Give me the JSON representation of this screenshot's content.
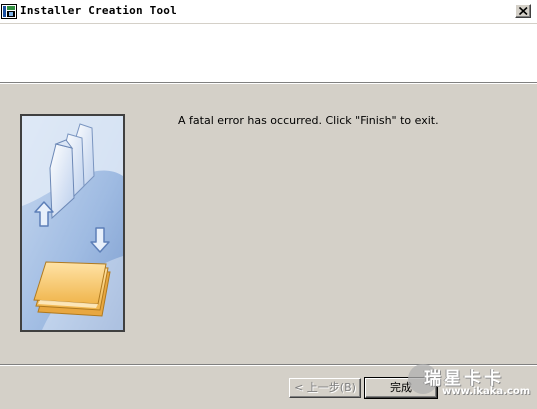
{
  "window": {
    "title": "Installer Creation Tool",
    "icon": "installer-app-icon"
  },
  "main": {
    "message": "A fatal error has occurred. Click \"Finish\" to exit.",
    "illustration": "folders-transfer-illustration"
  },
  "buttons": {
    "back_label": "< 上一步(B)",
    "back_enabled": false,
    "finish_label": "完成"
  },
  "watermark": {
    "brand": "瑞星卡卡",
    "url": "www.ikaka.com"
  },
  "colors": {
    "dialog_bg": "#d4d0c8",
    "header_bg": "#ffffff",
    "illustration_blue": "#aac4e6",
    "illustration_orange": "#f5c872"
  }
}
